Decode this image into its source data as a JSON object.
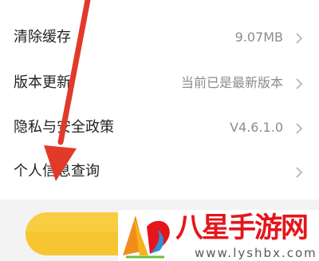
{
  "settings": {
    "items": [
      {
        "label": "清除缓存",
        "value": "9.07MB"
      },
      {
        "label": "版本更新",
        "value": "当前已是最新版本"
      },
      {
        "label": "隐私与安全政策",
        "value": "V4.6.1.0"
      },
      {
        "label": "个人信息查询",
        "value": ""
      }
    ]
  },
  "action_button": {
    "label": ""
  },
  "watermark": {
    "title": "八星手游网",
    "url": "www.lyshbx.com"
  },
  "colors": {
    "accent": "#f7c531",
    "annotation_arrow": "#e23a2a",
    "watermark_text": "#e4161b"
  },
  "icons": {
    "row_arrow": "chevron-right-icon"
  }
}
